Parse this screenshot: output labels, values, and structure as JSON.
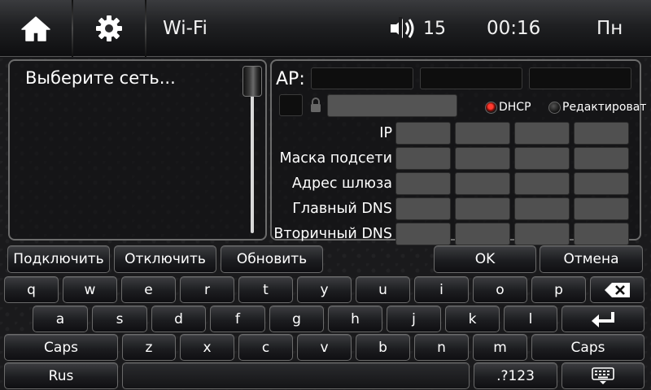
{
  "topbar": {
    "title": "Wi-Fi",
    "volume": "15",
    "time": "00:16",
    "day": "Пн",
    "icons": [
      "home-icon",
      "gear-icon",
      "volume-icon"
    ]
  },
  "networks": {
    "prompt": "Выберите сеть..."
  },
  "config": {
    "ap_label": "AP:",
    "dhcp_label": "DHCP",
    "edit_label": "Редактироват",
    "rows": [
      {
        "label": "IP"
      },
      {
        "label": "Маска подсети"
      },
      {
        "label": "Адрес шлюза"
      },
      {
        "label": "Главный DNS"
      },
      {
        "label": "Вторичный DNS"
      }
    ],
    "mode": "DHCP"
  },
  "actions": {
    "connect": "Подключить",
    "disconnect": "Отключить",
    "refresh": "Обновить",
    "ok": "OK",
    "cancel": "Отмена"
  },
  "keyboard": {
    "row1": [
      "q",
      "w",
      "e",
      "r",
      "t",
      "y",
      "u",
      "i",
      "o",
      "p"
    ],
    "row2": [
      "a",
      "s",
      "d",
      "f",
      "g",
      "h",
      "j",
      "k",
      "l"
    ],
    "row3": [
      "z",
      "x",
      "c",
      "v",
      "b",
      "n",
      "m"
    ],
    "caps": "Caps",
    "lang": "Rus",
    "symbols": ".?123",
    "icons": [
      "backspace-icon",
      "enter-icon",
      "keyboard-icon"
    ]
  },
  "colors": {
    "accent_radio": "#ff3b2f",
    "field_gray": "#505050",
    "field_dark": "#0e0e0e"
  }
}
